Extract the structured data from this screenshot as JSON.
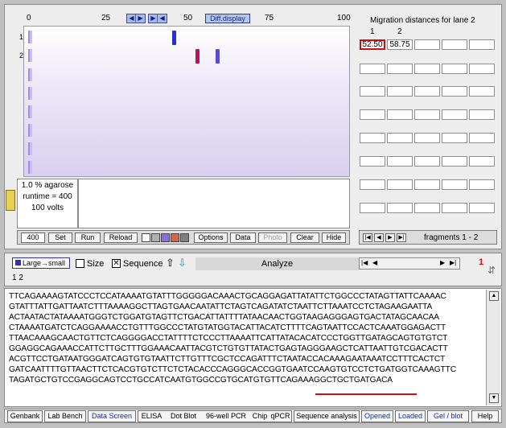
{
  "gel": {
    "ruler_ticks": [
      "0",
      "25",
      "50",
      "75",
      "100"
    ],
    "diff_display_label": "Diff.display",
    "lane_labels": [
      "1",
      "2"
    ],
    "info": {
      "agarose": "1.0 % agarose",
      "runtime": "runtime = 400",
      "volts": "100 volts"
    },
    "band_colors": {
      "lane1": "#3030c0",
      "lane2_a": "#c0105a",
      "lane2_b": "#5a48d8"
    }
  },
  "toolbar": {
    "runtime_value": "400",
    "set_label": "Set",
    "run_label": "Run",
    "reload_label": "Reload",
    "options_label": "Options",
    "data_label": "Data",
    "photo_label": "Photo",
    "clear_label": "Clear",
    "hide_label": "Hide",
    "swatch_colors": [
      "#ffffff",
      "#b0b0b0",
      "#8870e0",
      "#e06040",
      "#808080"
    ]
  },
  "migration": {
    "title": "Migration distances for lane 2",
    "col_headers": [
      "1",
      "2"
    ],
    "values": [
      "52.50",
      "58.75"
    ]
  },
  "fragments": {
    "label": "fragments  1 - 2"
  },
  "analyze_panel": {
    "mode_label": "Large→small",
    "size_label": "Size",
    "sequence_label": "Sequence",
    "analyze_label": "Analyze",
    "counter": "1",
    "list_text": "1  2"
  },
  "sequence": {
    "lines": [
      "TTCAGAAAAGTATCCCTCCATAAAATGTATTTGGGGGACAAACTGCAGGAGATTATATTCTGGCCCTATAGTTATTCAAAAC",
      "GTATTTATTGATTAATCTTTAAAAGGCTTAGTGAACAATATTCTAGTCAGATATCTAATTCTTAAATCCTCTAGAAGAATTA",
      "ACTAATACTATAAAATGGGTCTGGATGTAGTTCTGACATTATTTTATAACAACTGGTAAGAGGGAGTGACTATAGCAACAA",
      "CTAAAATGATCTCAGGAAAACCTGTTTGGCCCTATGTATGGTACATTACATCTTTTCAGTAATTCCACTCAAATGGAGACTT",
      "TTAACAAAGCAACTGTTCTCAGGGGACCTATTTTCTCCCTTAAAATTCATTATACACATCCCTGGTTGATAGCAGTGTGTCT",
      "GGAGGCAGAAACCATTCTTGCTTTGGAAACAATTACGTCTGTGTTATACTGAGTAGGGAAGCTCATTAATTGTCGACACTT",
      "ACGTTCCTGATAATGGGATCAGTGTGTAATTCTTGTTTCGCTCCAGATTTCTAATACCACAAAGAATAAATCCTTTCACTCT",
      "GATCAATTTTGTTAACTTCTCACGTGTCTTCTCTACACCCAGGGCACCGGTGAATCCAAGTGTCCTCTGATGGTCAAAGTTC",
      "TAGATGCTGTCCGAGGCAGTCCTGCCATCAATGTGGCCGTGCATGTGTTCAGAAAGGCTGCTGATGACA"
    ]
  },
  "bottom_nav": [
    "Genbank",
    "Lab Bench",
    "Data Screen",
    "ELISA",
    "Dot Blot",
    "96-well PCR",
    "Chip",
    "qPCR",
    "Sequence analysis",
    "Opened",
    "Loaded",
    "Gel / blot",
    "Help"
  ]
}
